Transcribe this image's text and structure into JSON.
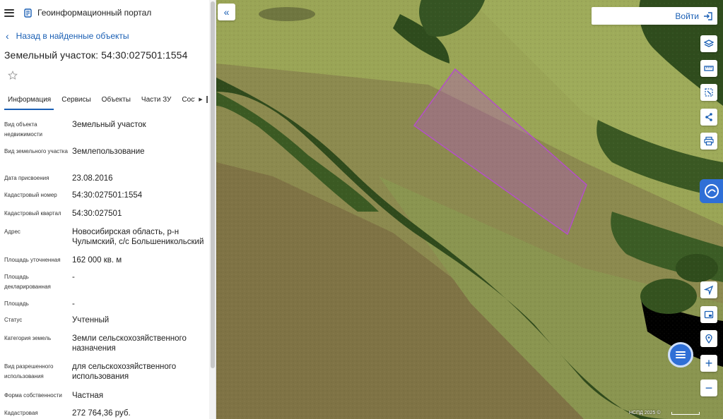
{
  "header": {
    "portal_title": "Геоинформационный портал"
  },
  "back_link": {
    "label": "Назад в найденные объекты"
  },
  "object": {
    "title": "Земельный участок: 54:30:027501:1554"
  },
  "tabs": [
    {
      "label": "Информация"
    },
    {
      "label": "Сервисы"
    },
    {
      "label": "Объекты"
    },
    {
      "label": "Части ЗУ"
    },
    {
      "label": "Состав"
    }
  ],
  "properties": [
    {
      "label": "Вид объекта недвижимости",
      "value": "Земельный участок"
    },
    {
      "label": "Вид земельного участка",
      "value": "Землепользование"
    },
    {
      "label": "Дата присвоения",
      "value": "23.08.2016"
    },
    {
      "label": "Кадастровый номер",
      "value": "54:30:027501:1554"
    },
    {
      "label": "Кадастровый квартал",
      "value": "54:30:027501"
    },
    {
      "label": "Адрес",
      "value": "Новосибирская область, р-н Чулымский, с/с Большеникольский"
    },
    {
      "label": "Площадь уточненная",
      "value": "162 000 кв. м"
    },
    {
      "label": "Площадь декларированная",
      "value": "-"
    },
    {
      "label": "Площадь",
      "value": "-"
    },
    {
      "label": "Статус",
      "value": "Учтенный"
    },
    {
      "label": "Категория земель",
      "value": "Земли сельскохозяйственного назначения"
    },
    {
      "label": "Вид разрешенного использования",
      "value": "для сельскохозяйственного использования"
    },
    {
      "label": "Форма собственности",
      "value": "Частная"
    },
    {
      "label": "Кадастровая",
      "value": "272 764,36 руб."
    }
  ],
  "map": {
    "login_label": "Войти",
    "copyright": "НСПД 2025 ©",
    "parcel_color": "#b44fc8"
  }
}
